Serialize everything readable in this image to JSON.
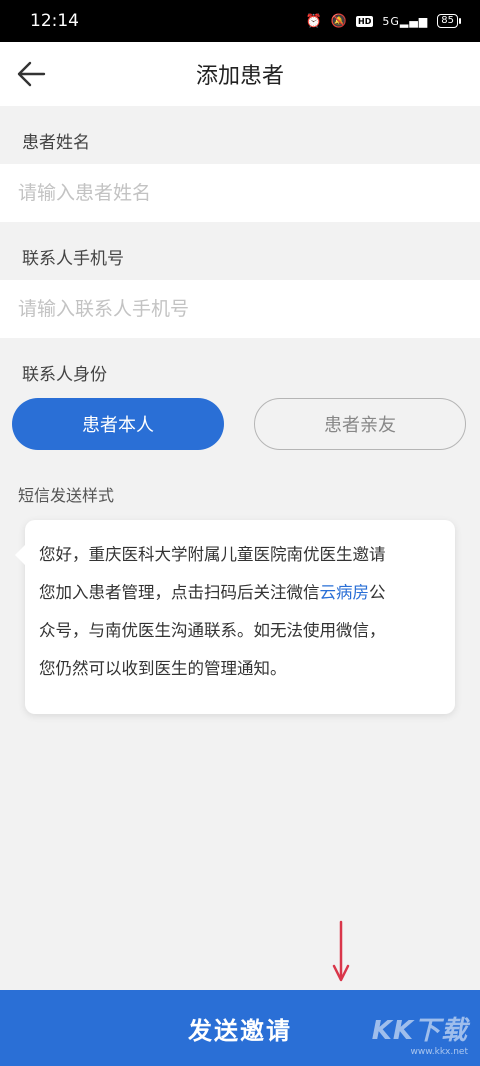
{
  "status_bar": {
    "time": "12:14",
    "battery": "85",
    "hd": "HD",
    "signal": "5G"
  },
  "header": {
    "title": "添加患者"
  },
  "form": {
    "name_label": "患者姓名",
    "name_placeholder": "请输入患者姓名",
    "name_value": "",
    "phone_label": "联系人手机号",
    "phone_placeholder": "请输入联系人手机号",
    "phone_value": "",
    "identity_label": "联系人身份",
    "identity_options": [
      "患者本人",
      "患者亲友"
    ],
    "identity_selected": "患者本人"
  },
  "sms": {
    "label": "短信发送样式",
    "line1": "您好，重庆医科大学附属儿童医院南优医生邀请",
    "line2_a": "您加入患者管理，点击扫码后关注微信",
    "line2_link": "云病房",
    "line2_b": "公",
    "line3": "众号，与南优医生沟通联系。如无法使用微信，",
    "line4": "您仍然可以收到医生的管理通知。"
  },
  "actions": {
    "send_label": "发送邀请"
  },
  "watermark": {
    "text": "KK下载",
    "sub": "www.kkx.net"
  },
  "colors": {
    "accent": "#2a6fd6",
    "annotation_arrow": "#d9364a"
  }
}
